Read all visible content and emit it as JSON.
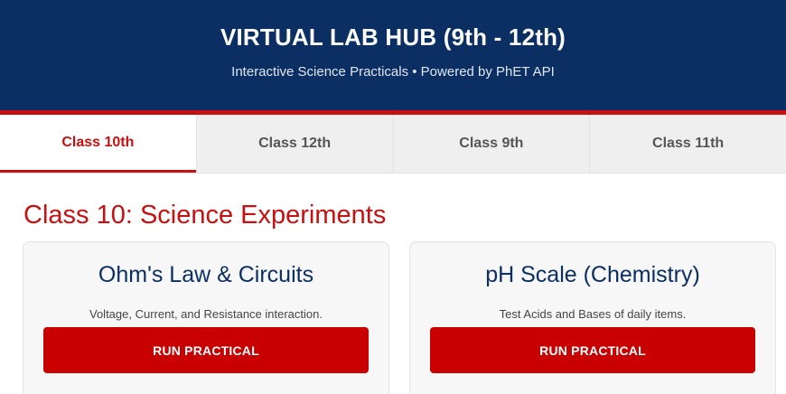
{
  "header": {
    "title": "VIRTUAL LAB HUB (9th - 12th)",
    "subtitle": "Interactive Science Practicals • Powered by PhET API"
  },
  "tabs": [
    {
      "label": "Class 10th",
      "active": true
    },
    {
      "label": "Class 12th",
      "active": false
    },
    {
      "label": "Class 9th",
      "active": false
    },
    {
      "label": "Class 11th",
      "active": false
    }
  ],
  "section": {
    "title": "Class 10: Science Experiments"
  },
  "cards": [
    {
      "title": "Ohm's Law & Circuits",
      "description": "Voltage, Current, and Resistance interaction.",
      "button_label": "RUN PRACTICAL"
    },
    {
      "title": "pH Scale (Chemistry)",
      "description": "Test Acids and Bases of daily items.",
      "button_label": "RUN PRACTICAL"
    }
  ],
  "colors": {
    "header_bg": "#0b2f63",
    "accent_red": "#c81010",
    "button_red": "#c80000",
    "card_title": "#0b2f63"
  }
}
